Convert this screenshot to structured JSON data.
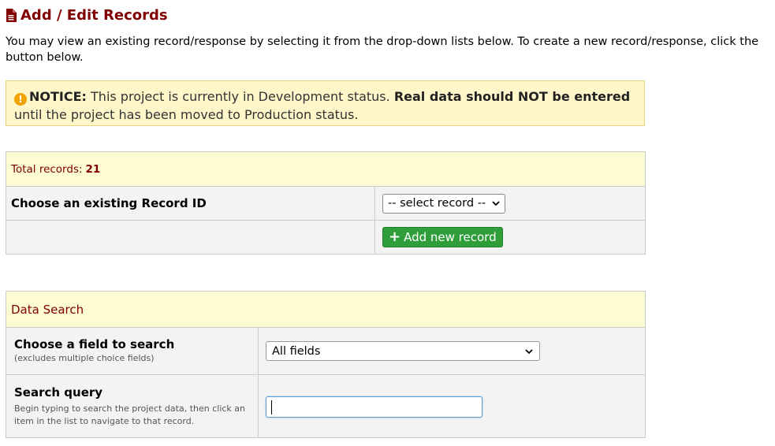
{
  "page": {
    "title": "Add / Edit Records",
    "title_icon": "file-icon",
    "intro": "You may view an existing record/response by selecting it from the drop-down lists below. To create a new record/response, click the button below."
  },
  "notice": {
    "icon": "warning-icon",
    "label": "NOTICE:",
    "text1": " This project is currently in Development status. ",
    "bold": "Real data should NOT be entered",
    "text2": " until the project has been moved to Production status."
  },
  "records": {
    "total_label": "Total records:",
    "total_value": "21",
    "choose_label": "Choose an existing Record ID",
    "select_value": "-- select record --",
    "add_button": "Add new record"
  },
  "search": {
    "header": "Data Search",
    "field_label": "Choose a field to search",
    "field_sub": "(excludes multiple choice fields)",
    "field_value": "All fields",
    "query_label": "Search query",
    "query_sub": "Begin typing to search the project data, then click an item in the list to navigate to that record.",
    "query_value": ""
  },
  "colors": {
    "title": "#800000",
    "notice_bg": "#fff7c9",
    "header_bg": "#fdfbd3",
    "add_button": "#2f9e3a"
  }
}
